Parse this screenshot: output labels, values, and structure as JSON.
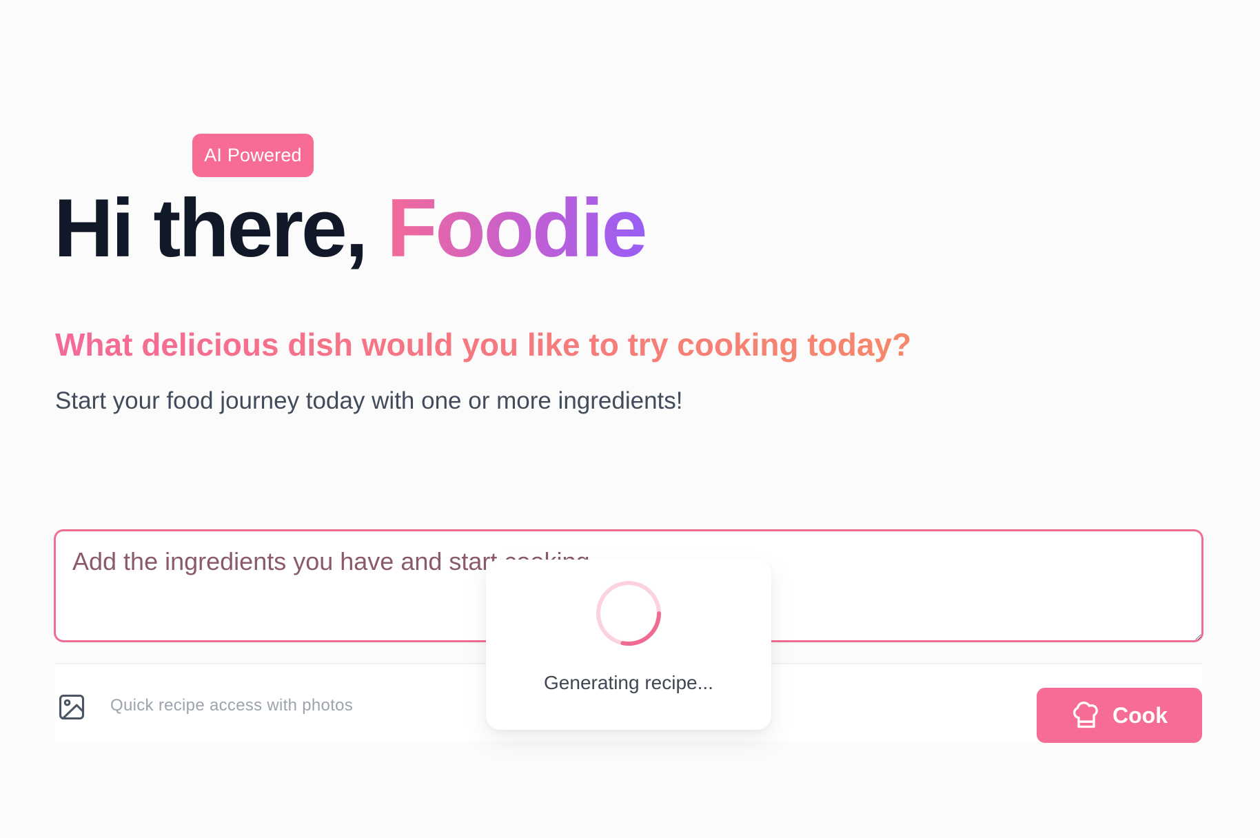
{
  "hero": {
    "badge": "AI Powered",
    "greeting": "Hi there,",
    "name": "Foodie",
    "subheadline": "What delicious dish would you like to try cooking today?",
    "tagline": "Start your food journey today with one or more ingredients!"
  },
  "ingredients": {
    "placeholder": "Add the ingredients you have and start cooking...",
    "value": ""
  },
  "toolbar": {
    "photo_icon": "image-icon",
    "photo_hint": "Quick recipe access with photos",
    "cook_icon": "chef-hat-icon",
    "cook_label": "Cook"
  },
  "loading": {
    "icon": "spinner-icon",
    "text": "Generating recipe..."
  },
  "colors": {
    "accent": "#f66c95",
    "gradient_name": [
      "#f46a97",
      "#985ef4"
    ],
    "gradient_subheadline": [
      "#f46a97",
      "#f6876a"
    ],
    "heading": "#111827"
  }
}
